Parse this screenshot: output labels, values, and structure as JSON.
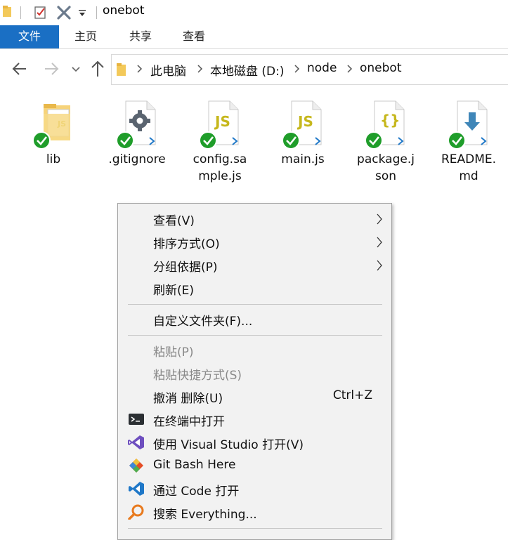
{
  "window": {
    "title": "onebot"
  },
  "quick_access": {
    "icons": [
      "folder-icon",
      "properties-icon",
      "delete-icon",
      "dropdown-icon"
    ]
  },
  "ribbon": {
    "tabs": [
      "文件",
      "主页",
      "共享",
      "查看"
    ],
    "active_tab_color": "#1a6fc4"
  },
  "navigation": {
    "breadcrumb": [
      "此电脑",
      "本地磁盘 (D:)",
      "node",
      "onebot"
    ]
  },
  "files": [
    {
      "name": "lib",
      "type": "folder"
    },
    {
      "name": ".gitignore",
      "type": "settings-file"
    },
    {
      "name": "config.sample.js",
      "type": "js-file"
    },
    {
      "name": "main.js",
      "type": "js-file"
    },
    {
      "name": "package.json",
      "type": "json-file"
    },
    {
      "name": "README.md",
      "type": "markdown-file"
    }
  ],
  "context_menu": {
    "items": [
      {
        "label": "查看(V)",
        "submenu": true,
        "enabled": true
      },
      {
        "label": "排序方式(O)",
        "submenu": true,
        "enabled": true
      },
      {
        "label": "分组依据(P)",
        "submenu": true,
        "enabled": true
      },
      {
        "label": "刷新(E)",
        "enabled": true
      },
      {
        "label": "自定义文件夹(F)...",
        "enabled": true
      },
      {
        "label": "粘贴(P)",
        "enabled": false
      },
      {
        "label": "粘贴快捷方式(S)",
        "enabled": false
      },
      {
        "label": "撤消 删除(U)",
        "shortcut": "Ctrl+Z",
        "enabled": true
      },
      {
        "label": "在终端中打开",
        "icon": "terminal-icon",
        "enabled": true
      },
      {
        "label": "使用 Visual Studio 打开(V)",
        "icon": "visual-studio-icon",
        "enabled": true
      },
      {
        "label": "Git Bash Here",
        "icon": "git-bash-icon",
        "enabled": true
      },
      {
        "label": "通过 Code 打开",
        "icon": "vscode-icon",
        "enabled": true
      },
      {
        "label": "搜索 Everything...",
        "icon": "everything-search-icon",
        "enabled": true
      }
    ]
  },
  "colors": {
    "sync_ok": "#1f9d2a",
    "js_badge": "#c6b71c",
    "vscode_blue": "#1f78c8"
  }
}
